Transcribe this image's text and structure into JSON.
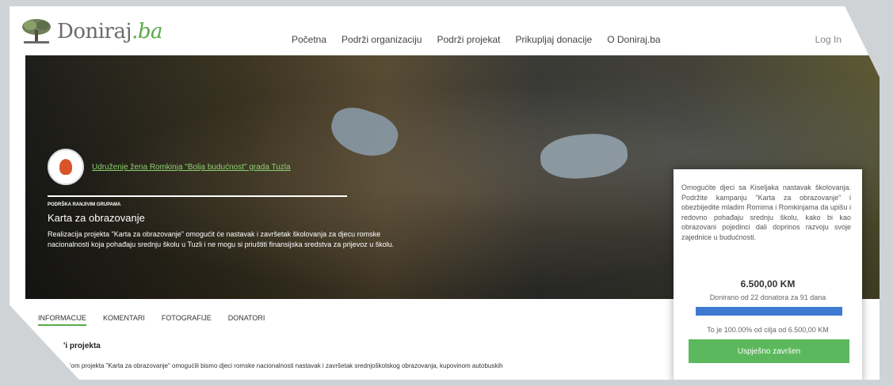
{
  "brand": {
    "name": "Doniraj",
    "suffix": ".ba"
  },
  "nav": {
    "items": [
      "Početna",
      "Podrži organizaciju",
      "Podrži projekat",
      "Prikupljaj donacije",
      "O Doniraj.ba"
    ],
    "login": "Log In"
  },
  "hero": {
    "org_name": "Udruženje žena Romkinja \"Bolja budućnost\" grada Tuzla",
    "category": "PODRŠKA RANJIVIM GRUPAMA",
    "title": "Karta za obrazovanje",
    "description": "Realizacija projekta \"Karta za obrazovanje\" omogućit će nastavak i završetak školovanja za djecu romske nacionalnosti koja pohađaju srednju školu u Tuzli i ne mogu si priuštiti finansijska sredstva za prijevoz u školu."
  },
  "tabs": [
    "INFORMACIJE",
    "KOMENTARI",
    "FOTOGRAFIJE",
    "DONATORI"
  ],
  "content": {
    "section_title": "'i projekta",
    "text": "'om projekta \"Karta za obrazovanje\" omogućili bismo djeci romske nacionalnosti nastavak i završetak srednjoškolskog obrazovanja, kupovinom autobuskih"
  },
  "card": {
    "text": "Omogućite djeci sa Kiseljaka nastavak školovanja. Podržite kampanju \"Karta za obrazovanje\" i obezbijedite mladim Romima i Romkinjama da upišu i redovno pohađaju srednju školu, kako bi kao obrazovani pojedinci dali doprinos razvoju svoje zajednice u budućnosti.",
    "amount": "6.500,00 KM",
    "donors": "Donirano od 22 donatora za 91 dana",
    "progress_fraction": 1.0,
    "goal": "To je 100.00% od cilja od 6.500,00 KM",
    "status_button": "Uspješno završen"
  },
  "colors": {
    "accent": "#5aa949",
    "progress": "#3e7bd0",
    "button": "#5cb85c"
  }
}
